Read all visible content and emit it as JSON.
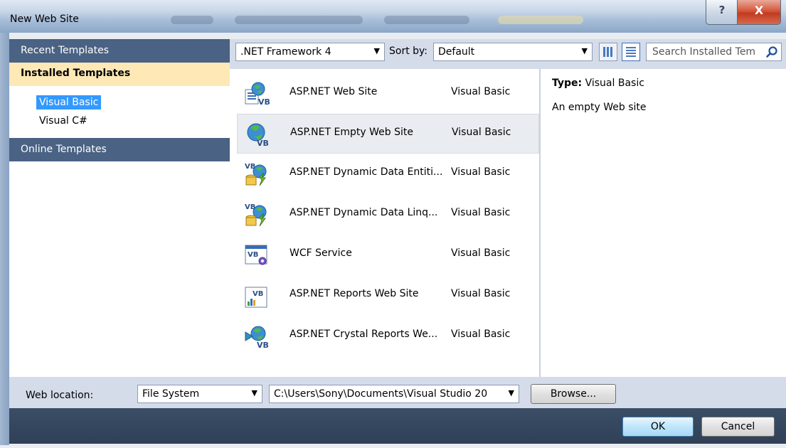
{
  "window": {
    "title": "New Web Site",
    "help_label": "?",
    "close_label": "X"
  },
  "sidebar": {
    "recent_label": "Recent Templates",
    "installed_label": "Installed Templates",
    "languages": [
      {
        "label": "Visual Basic",
        "selected": true
      },
      {
        "label": "Visual C#",
        "selected": false
      }
    ],
    "online_label": "Online Templates"
  },
  "toolbar": {
    "framework": ".NET Framework 4",
    "sort_label": "Sort by:",
    "sort_value": "Default",
    "search_placeholder": "Search Installed Tem"
  },
  "templates": [
    {
      "name": "ASP.NET Web Site",
      "language": "Visual Basic",
      "icon": "web-site-icon"
    },
    {
      "name": "ASP.NET Empty Web Site",
      "language": "Visual Basic",
      "icon": "empty-web-site-icon",
      "selected": true
    },
    {
      "name": "ASP.NET Dynamic Data Entiti...",
      "language": "Visual Basic",
      "icon": "dynamic-data-icon"
    },
    {
      "name": "ASP.NET Dynamic Data Linq...",
      "language": "Visual Basic",
      "icon": "dynamic-data-icon"
    },
    {
      "name": "WCF Service",
      "language": "Visual Basic",
      "icon": "wcf-service-icon"
    },
    {
      "name": "ASP.NET Reports Web Site",
      "language": "Visual Basic",
      "icon": "reports-icon"
    },
    {
      "name": "ASP.NET Crystal Reports We...",
      "language": "Visual Basic",
      "icon": "crystal-reports-icon"
    }
  ],
  "info": {
    "type_label": "Type:",
    "type_value": "Visual Basic",
    "description": "An empty Web site"
  },
  "bottom": {
    "web_location_label": "Web location:",
    "location_type": "File System",
    "path": "C:\\Users\\Sony\\Documents\\Visual Studio 20",
    "browse_label": "Browse...",
    "ok_label": "OK",
    "cancel_label": "Cancel"
  }
}
